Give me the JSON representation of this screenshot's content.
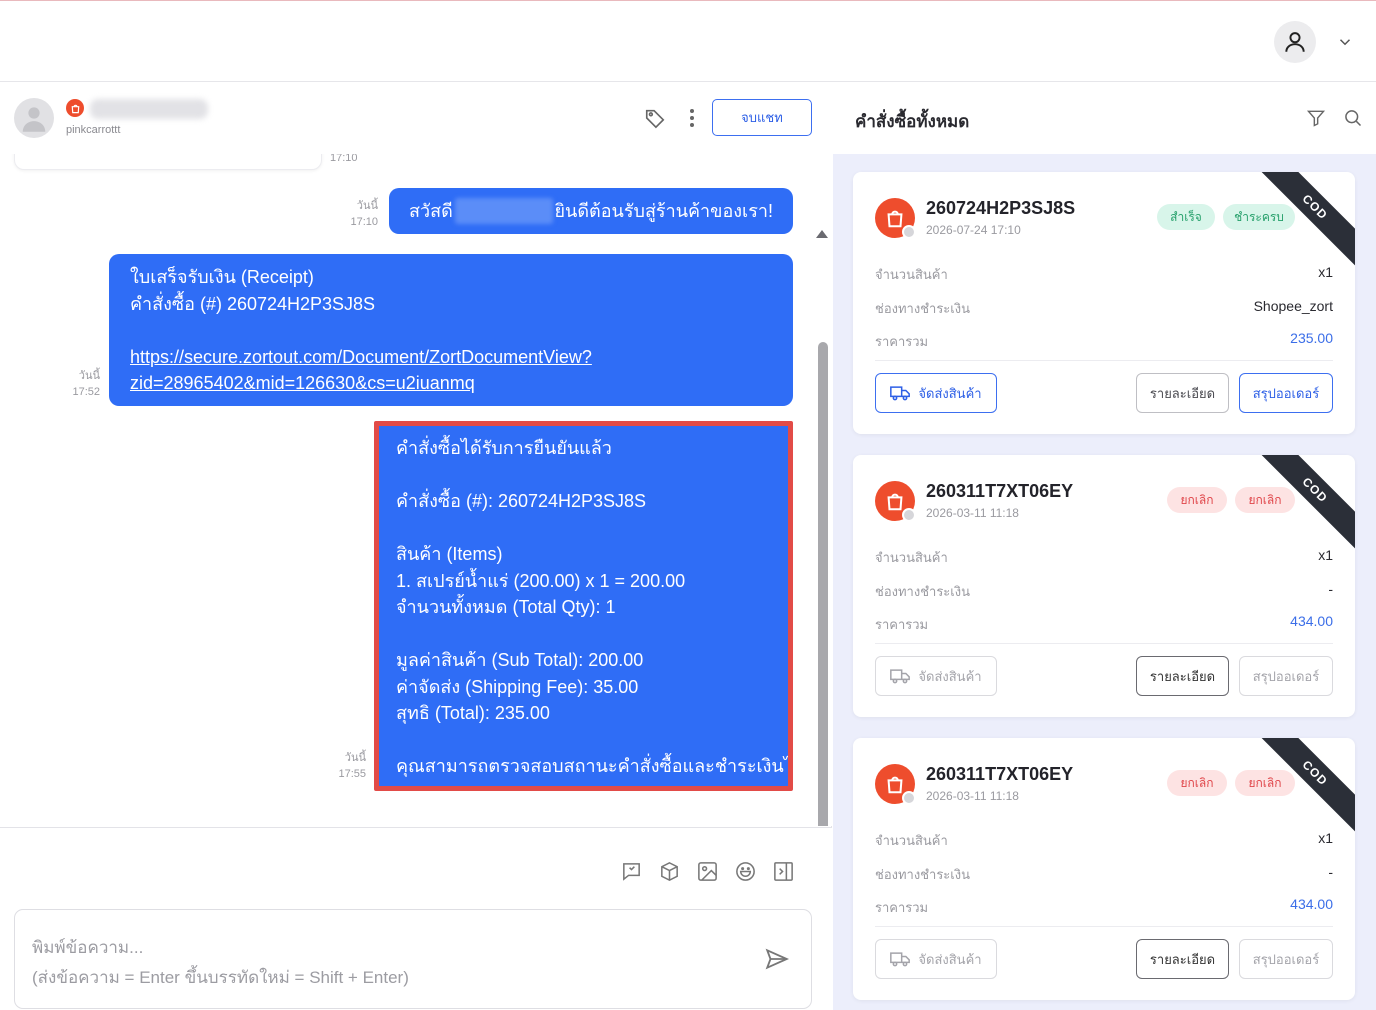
{
  "topbar": {
    "avatar_icon": "user-icon",
    "menu_icon": "chevron-down-icon"
  },
  "chat": {
    "customer_id": "pinkcarrottt",
    "end_chat_label": "จบแชท",
    "prev_time": "17:10",
    "messages": [
      {
        "day": "วันนี้",
        "time": "17:10",
        "greeting": "สวัสดี",
        "welcome": "ยินดีต้อนรับสู่ร้านค้าของเรา!"
      },
      {
        "day": "วันนี้",
        "time": "17:52",
        "line1": "ใบเสร็จรับเงิน (Receipt)",
        "line2": "คำสั่งซื้อ (#) 260724H2P3SJ8S",
        "link1": "https://secure.zortout.com/Document/ZortDocumentView?",
        "link2": "zid=28965402&mid=126630&cs=u2iuanmq"
      },
      {
        "day": "วันนี้",
        "time": "17:55",
        "l1": "คำสั่งซื้อได้รับการยืนยันแล้ว",
        "l2": "คำสั่งซื้อ (#): 260724H2P3SJ8S",
        "l3": "สินค้า (Items)",
        "l4": "1. สเปรย์น้ำแร่ (200.00) x 1 = 200.00",
        "l5": "จำนวนทั้งหมด (Total Qty): 1",
        "l6": "มูลค่าสินค้า (Sub Total): 200.00",
        "l7": "ค่าจัดส่ง (Shipping Fee): 35.00",
        "l8": "สุทธิ (Total): 235.00",
        "l9": "คุณสามารถตรวจสอบสถานะคำสั่งซื้อและชำระเงินได้ที่"
      }
    ],
    "composer": {
      "placeholder1": "พิมพ์ข้อความ...",
      "placeholder2": "(ส่งข้อความ = Enter ขึ้นบรรทัดใหม่ = Shift + Enter)"
    }
  },
  "orders": {
    "title": "คำสั่งซื้อทั้งหมด",
    "labels": {
      "qty": "จำนวนสินค้า",
      "payment": "ช่องทางชำระเงิน",
      "total": "ราคารวม",
      "ship": "จัดส่งสินค้า",
      "detail": "รายละเอียด",
      "summary": "สรุปออเดอร์",
      "cod": "COD"
    },
    "items": [
      {
        "order_no": "260724H2P3SJ8S",
        "date": "2026-07-24 17:10",
        "badge1": "สำเร็จ",
        "badge2": "ชำระครบ",
        "qty": "x1",
        "payment": "Shopee_zort",
        "total": "235.00"
      },
      {
        "order_no": "260311T7XT06EY",
        "date": "2026-03-11 11:18",
        "badge1": "ยกเลิก",
        "badge2": "ยกเลิก",
        "qty": "x1",
        "payment": "-",
        "total": "434.00"
      },
      {
        "order_no": "260311T7XT06EY",
        "date": "2026-03-11 11:18",
        "badge1": "ยกเลิก",
        "badge2": "ยกเลิก",
        "qty": "x1",
        "payment": "-",
        "total": "434.00"
      }
    ]
  }
}
